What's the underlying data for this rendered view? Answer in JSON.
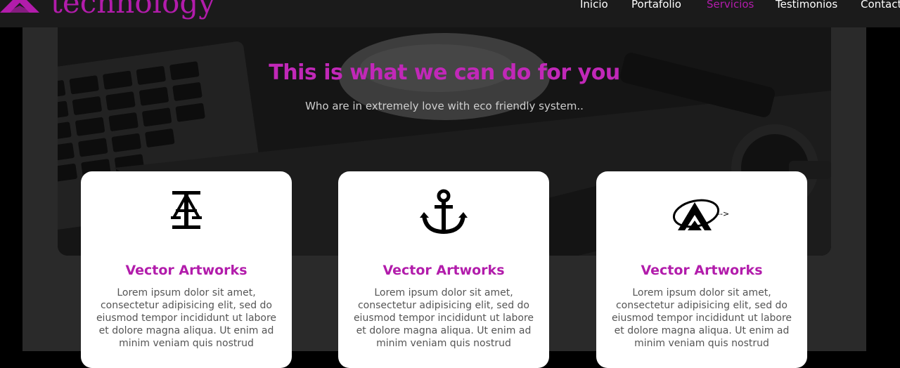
{
  "brand": {
    "name": "technology",
    "accent_color": "#b21cab"
  },
  "nav": {
    "items": [
      {
        "label": "Inicio"
      },
      {
        "label": "Portafolio"
      },
      {
        "label": "Servicios",
        "active": true
      },
      {
        "label": "Testimonios"
      },
      {
        "label": "Contact"
      }
    ]
  },
  "hero": {
    "title": "This is what we can do for you",
    "subtitle": "Who are in extremely love with eco friendly system.."
  },
  "cards": [
    {
      "icon": "typography-a-icon",
      "title": "Vector Artworks",
      "text": "Lorem ipsum dolor sit amet, consectetur adipisicing elit, sed do eiusmod tempor incididunt ut labore et dolore magna aliqua. Ut enim ad minim veniam quis nostrud"
    },
    {
      "icon": "anchor-icon",
      "title": "Vector Artworks",
      "text": "Lorem ipsum dolor sit amet, consectetur adipisicing elit, sed do eiusmod tempor incididunt ut labore et dolore magna aliqua. Ut enim ad minim veniam quis nostrud"
    },
    {
      "icon": "arrow-a-logo-icon",
      "icon_caption": "-->",
      "title": "Vector Artworks",
      "text": "Lorem ipsum dolor sit amet, consectetur adipisicing elit, sed do eiusmod tempor incididunt ut labore et dolore magna aliqua. Ut enim ad minim veniam quis nostrud"
    }
  ]
}
